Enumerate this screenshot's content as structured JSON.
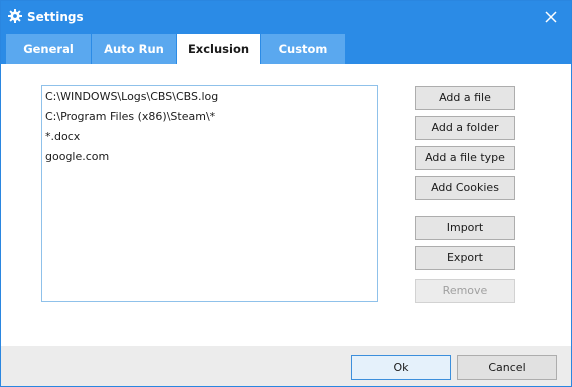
{
  "window": {
    "title": "Settings",
    "title_icon": "gear-icon",
    "close_icon": "close-icon",
    "accent_color": "#2b8be6"
  },
  "tabs": [
    {
      "label": "General",
      "active": false
    },
    {
      "label": "Auto Run",
      "active": false
    },
    {
      "label": "Exclusion",
      "active": true
    },
    {
      "label": "Custom",
      "active": false
    }
  ],
  "exclusion_list": {
    "items": [
      "C:\\WINDOWS\\Logs\\CBS\\CBS.log",
      "C:\\Program Files (x86)\\Steam\\*",
      "*.docx",
      "google.com"
    ]
  },
  "actions": {
    "add_file": "Add a file",
    "add_folder": "Add a folder",
    "add_file_type": "Add a file type",
    "add_cookies": "Add Cookies",
    "import": "Import",
    "export": "Export",
    "remove": "Remove"
  },
  "footer": {
    "ok": "Ok",
    "cancel": "Cancel"
  }
}
